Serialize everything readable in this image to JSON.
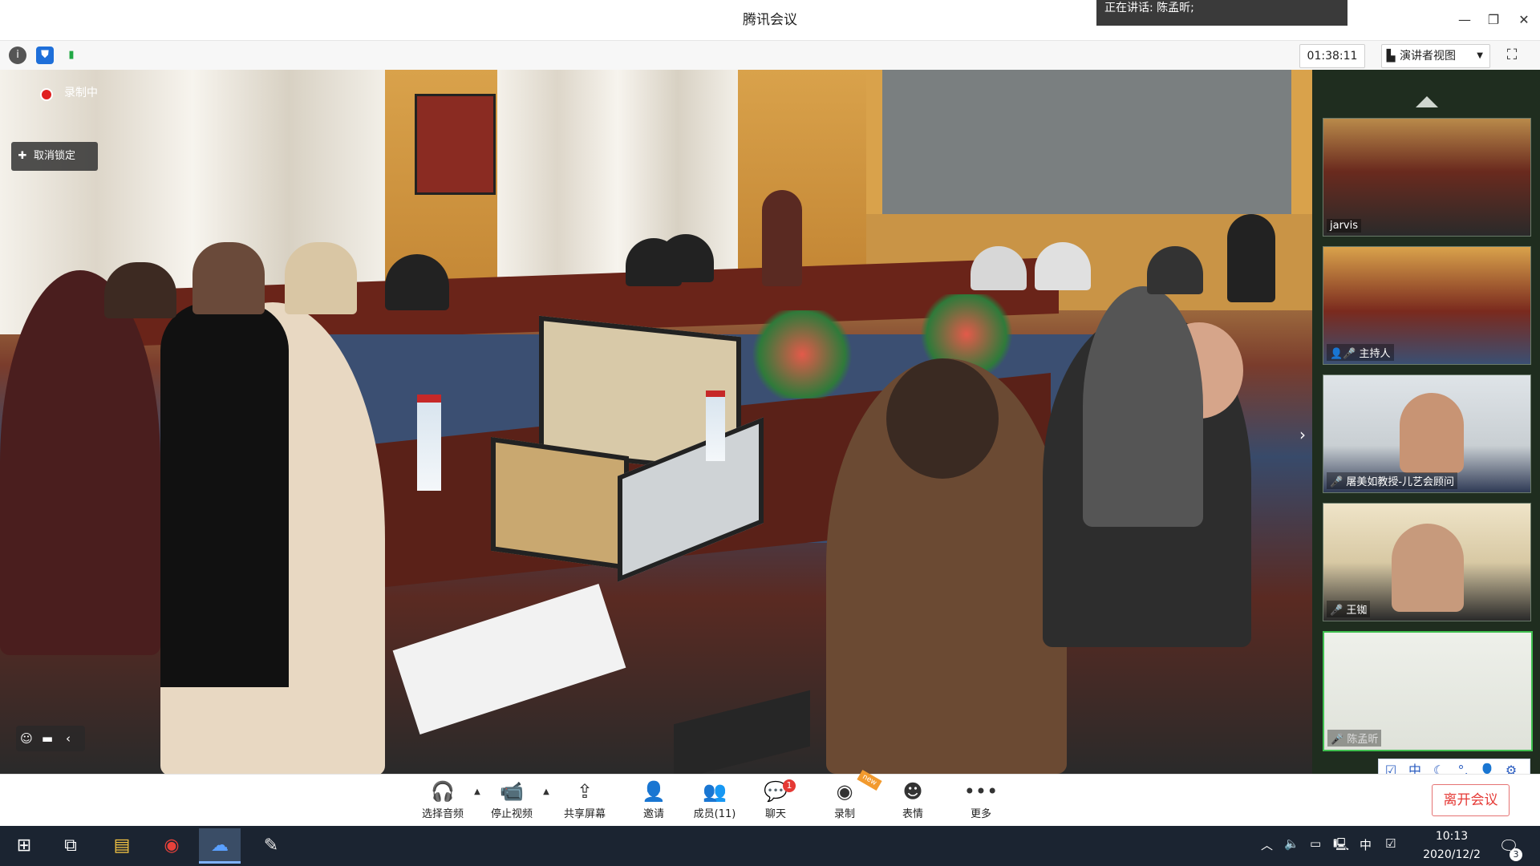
{
  "app": {
    "title": "腾讯会议"
  },
  "speaking_banner": "正在讲话: 陈孟昕;",
  "window_controls": {
    "minimize": "—",
    "restore": "❐",
    "close": "✕"
  },
  "top_toolbar": {
    "info_icon": "i",
    "shield_icon": "⛊",
    "signal_icon": "▮",
    "timer": "01:38:11",
    "view_mode": "演讲者视图",
    "fullscreen_icon": "⛶"
  },
  "main_video": {
    "recording_label": "录制中",
    "unlock_label": "取消锁定"
  },
  "gallery": {
    "tiles": [
      {
        "label": "jarvis"
      },
      {
        "label": "主持人"
      },
      {
        "label": "屠美如教授-儿艺会顾问"
      },
      {
        "label": "王铷"
      },
      {
        "label": "陈孟昕"
      }
    ]
  },
  "ime_bar": {
    "items": [
      "☑",
      "中",
      "☾",
      "°,",
      "👤",
      "⚙"
    ]
  },
  "bottom_toolbar": {
    "buttons": [
      {
        "label": "选择音频",
        "icon": "headset-icon",
        "glyph": "🎧"
      },
      {
        "label": "停止视频",
        "icon": "video-camera-icon",
        "glyph": "📹"
      },
      {
        "label": "共享屏幕",
        "icon": "share-screen-icon",
        "glyph": "⇪"
      },
      {
        "label": "邀请",
        "icon": "invite-icon",
        "glyph": "👤"
      },
      {
        "label": "成员(11)",
        "icon": "members-icon",
        "glyph": "👥"
      },
      {
        "label": "聊天",
        "icon": "chat-icon",
        "glyph": "💬"
      },
      {
        "label": "录制",
        "icon": "record-icon",
        "glyph": "◉"
      },
      {
        "label": "表情",
        "icon": "emoji-icon",
        "glyph": "☻"
      },
      {
        "label": "更多",
        "icon": "more-icon",
        "glyph": "•••"
      }
    ],
    "chat_badge": "1",
    "new_tag": "new",
    "leave_button": "离开会议"
  },
  "taskbar": {
    "time": "10:13",
    "date": "2020/12/2",
    "ime_indicator": "中",
    "notification_count": "3"
  }
}
